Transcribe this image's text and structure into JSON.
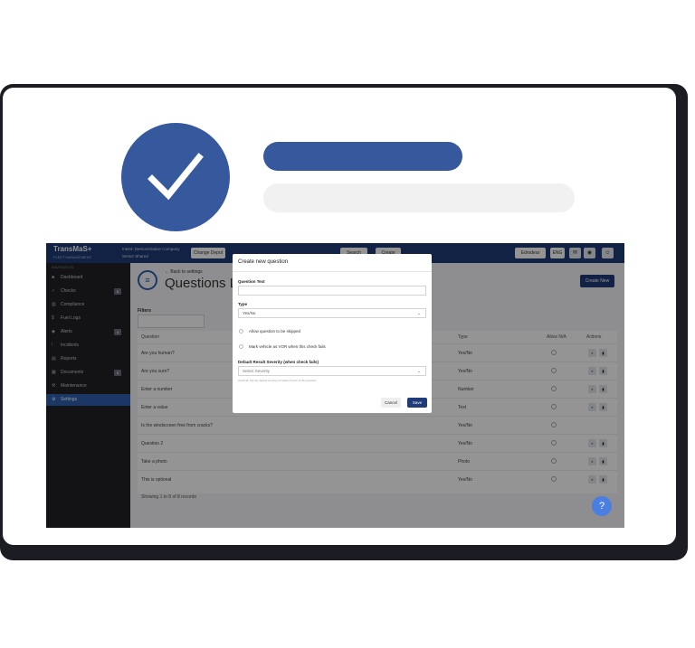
{
  "colors": {
    "accent": "#36589c",
    "nav": "#1f3b78",
    "sidebar": "#212226",
    "active": "#2d5fb0"
  },
  "hero": {
    "check_icon": "check-icon"
  },
  "topbar": {
    "brand": "TransMaS+",
    "brand_sub": "FLEET MANAGEMENT",
    "company_line1": "Intent: Demonstration Company",
    "company_line2": "Senior Shared",
    "change_btn": "Change Depot",
    "search_btn": "Search",
    "create_btn": "Create",
    "user_btn": "Edrodear",
    "lang_btn": "ENG"
  },
  "sidebar": {
    "heading": "NAVIGATION",
    "items": [
      {
        "label": "Dashboard",
        "icon": "dashboard-icon",
        "badge": ""
      },
      {
        "label": "Checks",
        "icon": "check-icon",
        "badge": "8"
      },
      {
        "label": "Compliance",
        "icon": "compliance-icon",
        "badge": ""
      },
      {
        "label": "Fuel Logs",
        "icon": "fuel-icon",
        "badge": ""
      },
      {
        "label": "Alerts",
        "icon": "alert-icon",
        "badge": "4"
      },
      {
        "label": "Incidents",
        "icon": "incident-icon",
        "badge": ""
      },
      {
        "label": "Reports",
        "icon": "report-icon",
        "badge": ""
      },
      {
        "label": "Documents",
        "icon": "document-icon",
        "badge": "5"
      },
      {
        "label": "Maintenance",
        "icon": "wrench-icon",
        "badge": ""
      },
      {
        "label": "Settings",
        "icon": "gear-icon",
        "badge": ""
      }
    ]
  },
  "main": {
    "back_link": "← Back to settings",
    "title": "Questions L",
    "create_new": "Create New",
    "filters_label": "Filters",
    "table": {
      "headers": [
        "Question",
        "Type",
        "Allow N/A",
        "Actions"
      ],
      "rows": [
        {
          "question": "Are you human?",
          "type": "Yes/No"
        },
        {
          "question": "Are you sure?",
          "type": "Yes/No"
        },
        {
          "question": "Enter a number",
          "type": "Number"
        },
        {
          "question": "Enter a value",
          "type": "Text"
        },
        {
          "question": "Is the windscreen free from cracks?",
          "type": "Yes/No"
        },
        {
          "question": "Question 2",
          "type": "Yes/No"
        },
        {
          "question": "Take a photo",
          "type": "Photo"
        },
        {
          "question": "This is optional",
          "type": "Yes/No"
        }
      ]
    },
    "showing": "Showing 1 to 8 of 8 records",
    "help": "?"
  },
  "modal": {
    "title": "Create new question",
    "question_text_label": "Question Text",
    "question_text_value": "",
    "type_label": "Type",
    "type_value": "Yes/No",
    "option_skip": "Allow question to be skipped",
    "option_vor": "Mark vehicle as VOR when this check fails",
    "severity_label": "Default Result Severity (when check fails)",
    "severity_placeholder": "Select Severity",
    "severity_help": "Optional: Set the default severity for failed checks of this question",
    "cancel": "Cancel",
    "save": "Save"
  }
}
